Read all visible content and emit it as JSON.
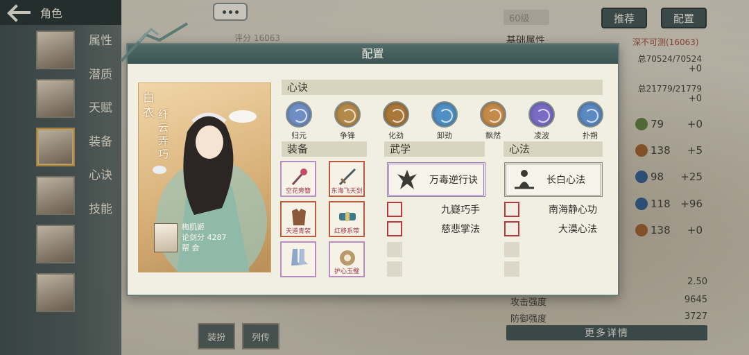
{
  "topbar": {
    "title": "角色"
  },
  "side_menu": [
    "属性",
    "潜质",
    "天赋",
    "装备",
    "心诀",
    "技能"
  ],
  "score_top": "评分 16063",
  "right_panel": {
    "level": "60级",
    "buttons": {
      "recommend": "推荐",
      "config": "配置"
    },
    "base_title": "基础属性",
    "power_label": "深不可测(16063)",
    "hp": "总70524/70524",
    "hp_plus": "+0",
    "mp": "总21779/21779",
    "mp_plus": "+0",
    "rows": [
      {
        "value": "79",
        "add": "+0"
      },
      {
        "value": "138",
        "add": "+5"
      },
      {
        "value": "98",
        "add": "+25"
      },
      {
        "value": "118",
        "add": "+96"
      },
      {
        "value": "138",
        "add": "+0"
      }
    ],
    "bottom_stats": [
      {
        "label": "",
        "value": "2.50"
      },
      {
        "label": "攻击强度",
        "value": "9645"
      },
      {
        "label": "防御强度",
        "value": "3727"
      }
    ],
    "more_button": "更多详情"
  },
  "bottom_tabs": [
    "装扮",
    "列传"
  ],
  "modal": {
    "title": "配置",
    "portrait": {
      "name_main": "白衣",
      "name_sub": "纤云弄巧",
      "player_name": "梅肌姬",
      "score_label": "论剑分",
      "score_value": "4287",
      "guild": "帮 会"
    },
    "xinjue": {
      "title": "心诀",
      "skills": [
        {
          "label": "归元",
          "color": "#6f8fc4",
          "icon": "spirit-orb-icon"
        },
        {
          "label": "争锋",
          "color": "#b48a4a",
          "icon": "claw-orb-icon"
        },
        {
          "label": "化劲",
          "color": "#a9773a",
          "icon": "swirl-orb-icon"
        },
        {
          "label": "卸劲",
          "color": "#4f8fc4",
          "icon": "wave-orb-icon"
        },
        {
          "label": "飘然",
          "color": "#c48a4a",
          "icon": "feather-orb-icon"
        },
        {
          "label": "凌波",
          "color": "#7a6bc4",
          "icon": "ripple-orb-icon"
        },
        {
          "label": "扑朔",
          "color": "#5b89c1",
          "icon": "mist-orb-icon"
        }
      ]
    },
    "equipment": {
      "title": "装备",
      "slots": [
        {
          "label": "空花旁簪",
          "border": "#b58dbe",
          "icon": "hairpin-icon"
        },
        {
          "label": "东海飞天剑",
          "border": "#b95b3f",
          "icon": "sword-icon"
        },
        {
          "label": "天道青袈",
          "border": "#b95b3f",
          "icon": "armor-icon"
        },
        {
          "label": "红移系带",
          "border": "#b95b3f",
          "icon": "belt-icon"
        },
        {
          "label": "",
          "border": "#b58dbe",
          "icon": "boots-icon"
        },
        {
          "label": "护心玉璧",
          "border": "#b58dbe",
          "icon": "jade-pendant-icon"
        }
      ]
    },
    "martial": {
      "title": "武学",
      "main": "万毒逆行诀",
      "subs": [
        "九嶷巧手",
        "慈悲掌法"
      ]
    },
    "mind": {
      "title": "心法",
      "main": "长白心法",
      "subs": [
        "南海静心功",
        "大漠心法"
      ]
    }
  }
}
